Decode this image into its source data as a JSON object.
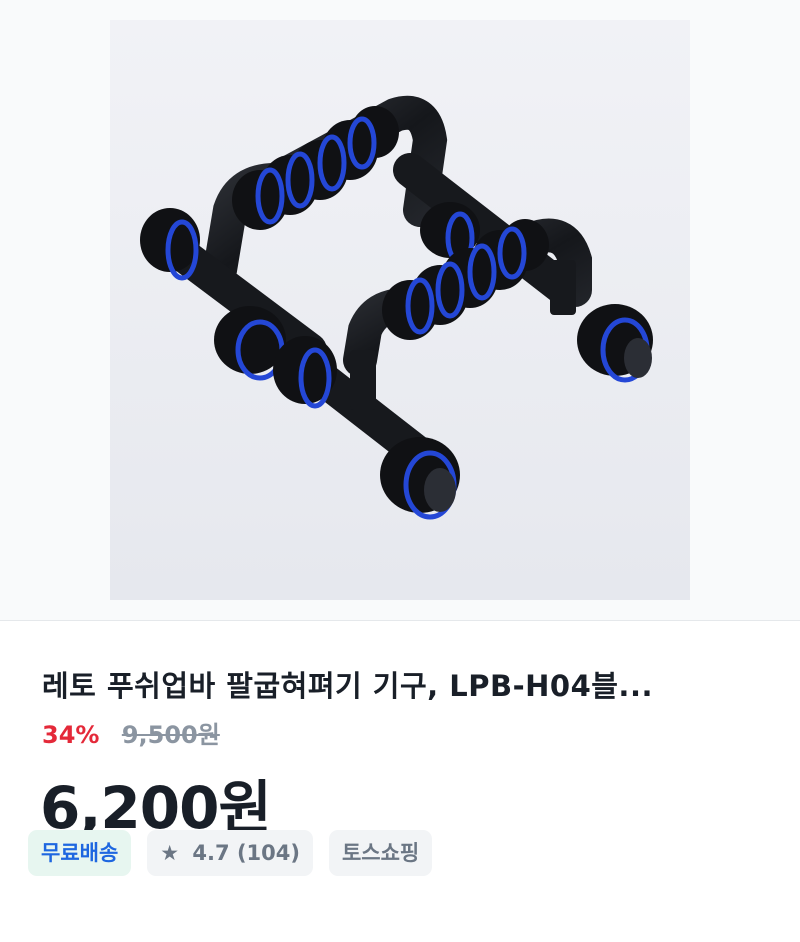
{
  "product": {
    "title": "레토 푸쉬업바 팔굽혀펴기 기구, LPB-H04블...",
    "discount": "34%",
    "original_price": "9,500원",
    "price": "6,200원",
    "badges": {
      "shipping": "무료배송",
      "star_icon": "star-icon",
      "rating": "4.7",
      "review_count": "(104)",
      "store": "토스쇼핑"
    }
  },
  "colors": {
    "discount": "#e42939",
    "shipping_text": "#1e67e0",
    "shipping_bg": "#e7f6f0"
  }
}
